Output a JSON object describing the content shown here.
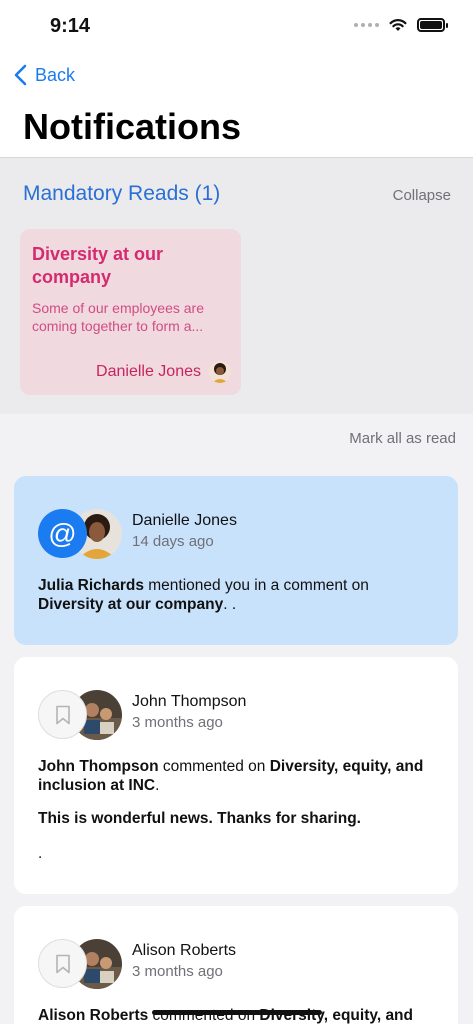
{
  "status": {
    "time": "9:14"
  },
  "nav": {
    "back_label": "Back",
    "title": "Notifications"
  },
  "mandatory": {
    "section_title": "Mandatory Reads (1)",
    "collapse_label": "Collapse",
    "card": {
      "title": "Diversity at our company",
      "excerpt": "Some of our employees are coming together to form a...",
      "author": "Danielle Jones"
    }
  },
  "mark_all_label": "Mark all as read",
  "notifications": [
    {
      "type": "mention",
      "icon": "at-icon",
      "name": "Danielle Jones",
      "time": "14 days ago",
      "actor": "Julia Richards",
      "action": " mentioned you in a comment on ",
      "target": "Diversity at our company",
      "suffix": ". ."
    },
    {
      "type": "comment",
      "icon": "bookmark-icon",
      "name": "John Thompson",
      "time": "3 months ago",
      "actor": "John Thompson",
      "action": " commented on ",
      "target": "Diversity, equity, and inclusion at INC",
      "suffix": ".",
      "comment": "This is wonderful news. Thanks for sharing.",
      "extra": "."
    },
    {
      "type": "comment",
      "icon": "bookmark-icon",
      "name": "Alison Roberts",
      "time": "3 months ago",
      "actor": "Alison Roberts",
      "action": " commented on ",
      "target": "Diversity, equity, and"
    }
  ],
  "colors": {
    "accent": "#1a7cf0",
    "section_title": "#2a6fd4",
    "mandatory_card_bg": "#f0d9df",
    "mandatory_card_text": "#d42a6e",
    "unread_bg": "#c9e2fc"
  }
}
